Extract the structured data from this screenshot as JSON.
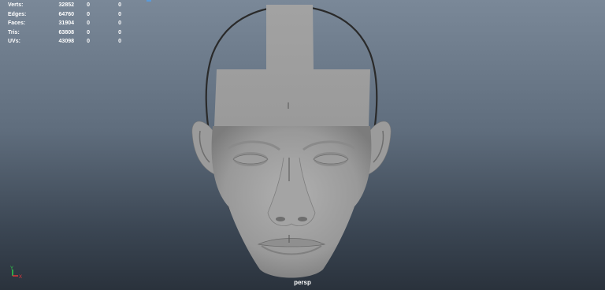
{
  "hud": {
    "rows": [
      {
        "label": "Verts:",
        "v1": "32852",
        "v2": "0",
        "v3": "0"
      },
      {
        "label": "Edges:",
        "v1": "64760",
        "v2": "0",
        "v3": "0"
      },
      {
        "label": "Faces:",
        "v1": "31904",
        "v2": "0",
        "v3": "0"
      },
      {
        "label": "Tris:",
        "v1": "63808",
        "v2": "0",
        "v3": "0"
      },
      {
        "label": "UVs:",
        "v1": "43098",
        "v2": "0",
        "v3": "0"
      }
    ]
  },
  "axis": {
    "y_label": "Y",
    "x_label": "X",
    "y_color": "#2fd14a",
    "x_color": "#e0393b"
  },
  "camera_label": "persp",
  "colors": {
    "bg_top": "#7a8898",
    "bg_bottom": "#2a323c",
    "mesh": "#a8a8a8",
    "hud_text": "#ffffff"
  }
}
